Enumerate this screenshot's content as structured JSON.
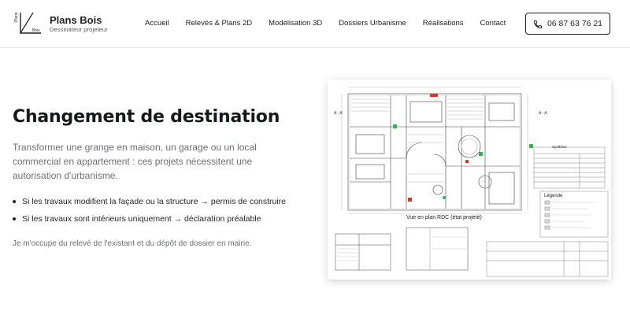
{
  "brand": {
    "name": "Plans Bois",
    "tagline": "Dessinateur projeteur",
    "logo_text_top": "Plans",
    "logo_text_bottom": "Bois",
    "logo_icon": "house-outline-logo"
  },
  "nav": {
    "items": [
      {
        "label": "Accueil"
      },
      {
        "label": "Relevés & Plans 2D"
      },
      {
        "label": "Modélisation 3D"
      },
      {
        "label": "Dossiers Urbanisme"
      },
      {
        "label": "Réalisations"
      },
      {
        "label": "Contact"
      }
    ]
  },
  "phone": {
    "icon": "phone-icon",
    "number": "06 87 63 76 21"
  },
  "hero": {
    "title": "Changement de destination",
    "intro": "Transformer une grange en maison, un garage ou un local commercial en appartement : ces projets nécessitent une autorisation d'urbanisme.",
    "bullets": [
      "Si les travaux modifient la façade ou la structure → permis de construire",
      "Si les travaux sont intérieurs uniquement → déclaration préalable"
    ],
    "note": "Je m'occupe du relevé de l'existant et du dépôt de dossier en mairie."
  },
  "plan": {
    "caption": "Vue en plan RDC (état projeté)",
    "legend_title": "Légende",
    "synthese_title": "Synthèse",
    "section_label_left": "A - A",
    "section_label_right": "A - A"
  },
  "colors": {
    "text_dark": "#15181c",
    "text_muted": "#6b7177",
    "border": "#1f2328",
    "plan_green": "#2fb84a",
    "plan_red": "#d8342c"
  }
}
